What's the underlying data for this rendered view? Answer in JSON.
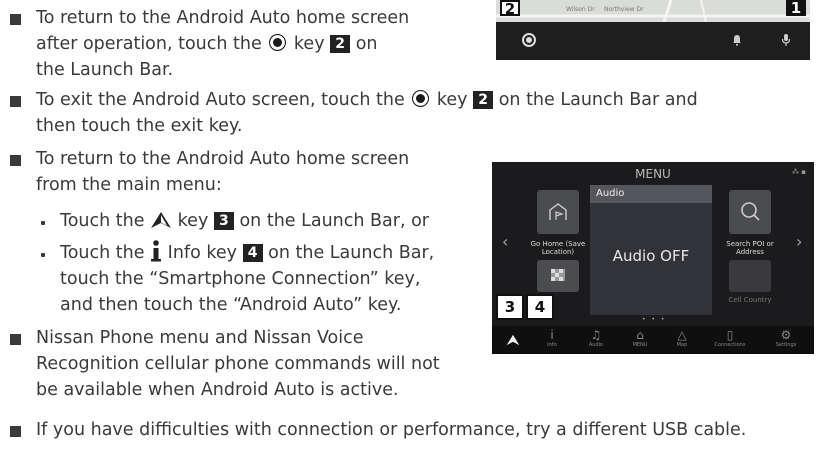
{
  "bullets": {
    "b1": {
      "line1": "To return to the Android Auto home screen",
      "line2a": "after operation, touch the",
      "line2b": "key",
      "line2c": "on",
      "line3": "the Launch Bar.",
      "key_num": "2"
    },
    "b2": {
      "line1a": "To exit the Android Auto screen, touch the",
      "line1b": "key",
      "line1c": "on the Launch Bar and",
      "line2": "then touch the exit key.",
      "key_num": "2"
    },
    "b3": {
      "line1": "To return to the Android Auto home screen",
      "line2": "from the main menu:"
    },
    "sub1": {
      "a": "Touch the",
      "b": "key",
      "c": "on the Launch Bar, or",
      "key_num": "3"
    },
    "sub2": {
      "a": "Touch the",
      "b": "Info key",
      "c": "on the Launch Bar,",
      "line2": "touch the “Smartphone Connection” key,",
      "line3": "and then touch the “Android Auto” key.",
      "key_num": "4"
    },
    "b4": {
      "line1": "Nissan Phone menu and Nissan Voice",
      "line2": "Recognition cellular phone commands will not",
      "line3": "be available when Android Auto is active."
    },
    "b5": {
      "line1": "If you have difficulties with connection or performance, try a different USB cable."
    }
  },
  "top_screen": {
    "label_left": "2",
    "label_right": "1",
    "street1": "Wilson Dr",
    "street2": "Northview Dr"
  },
  "menu_screen": {
    "title": "MENU",
    "tile_home": "Go Home (Save Location)",
    "tile_search": "Search POI or Address",
    "tile_last": "Cell Country",
    "audio_head": "Audio",
    "audio_state": "Audio OFF",
    "label_3": "3",
    "label_4": "4",
    "bar": [
      "Info",
      "Audio",
      "MENU",
      "Map",
      "Connections",
      "Settings"
    ]
  }
}
